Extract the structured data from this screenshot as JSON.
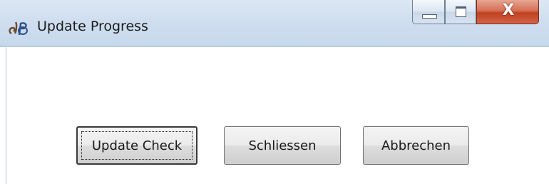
{
  "window": {
    "title": "Update Progress",
    "app_icon": "jp-logo-icon",
    "caption_buttons": {
      "minimize_icon": "minimize-icon",
      "maximize_icon": "maximize-icon",
      "close_glyph": "X"
    }
  },
  "buttons": {
    "update_check": "Update Check",
    "close": "Schliessen",
    "cancel": "Abbrechen"
  },
  "colors": {
    "titlebar": "#cfdeef",
    "close_button": "#c0401f",
    "window_background": "#ffffff"
  }
}
